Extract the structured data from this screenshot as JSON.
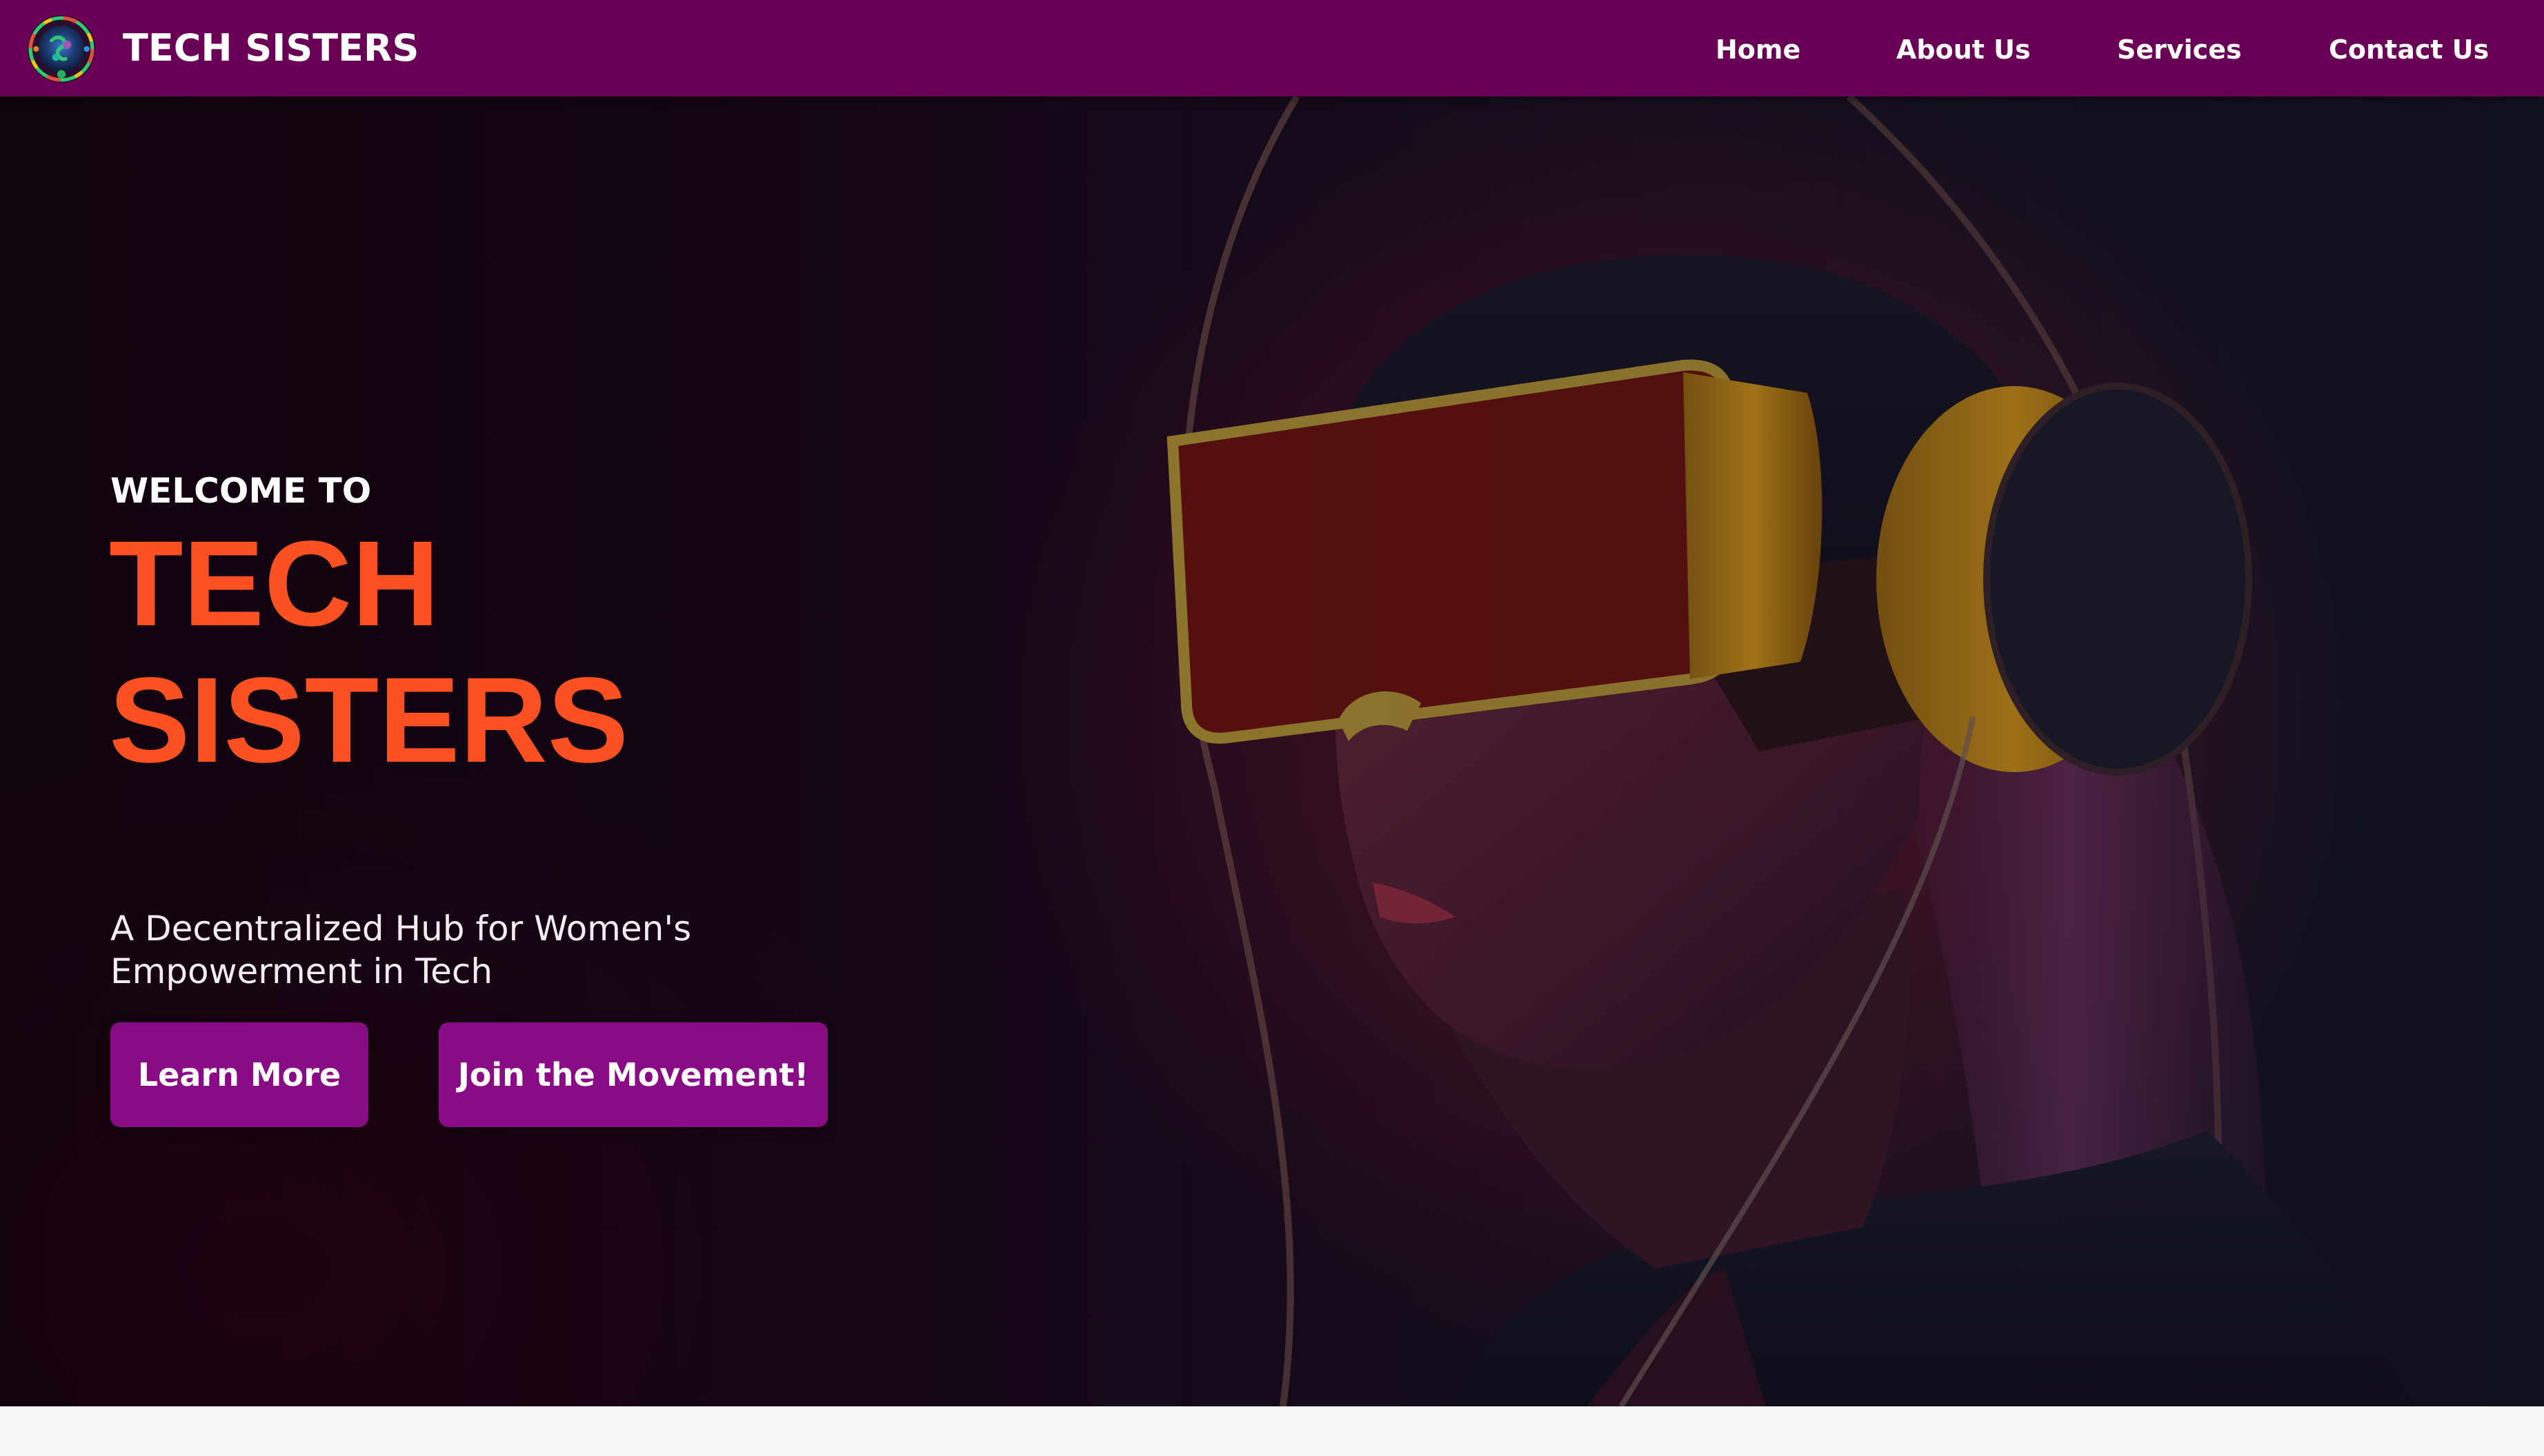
{
  "navbar": {
    "brand": "TECH SISTERS",
    "logo_icon": "globe-logo-icon",
    "background_color": "#6a0055",
    "links": [
      {
        "label": "Home"
      },
      {
        "label": "About Us"
      },
      {
        "label": "Services"
      },
      {
        "label": "Contact Us"
      }
    ]
  },
  "hero": {
    "welcome": "WELCOME TO",
    "title_line1": "TECH",
    "title_line2": "SISTERS",
    "title_color": "#fb5122",
    "tagline_line1": "A Decentralized Hub for Women's",
    "tagline_line2": "Empowerment in Tech",
    "background_image": "woman-vr-headset-image",
    "buttons": {
      "learn_more": "Learn More",
      "join": "Join the Movement!",
      "button_color": "#8a0b86"
    }
  }
}
